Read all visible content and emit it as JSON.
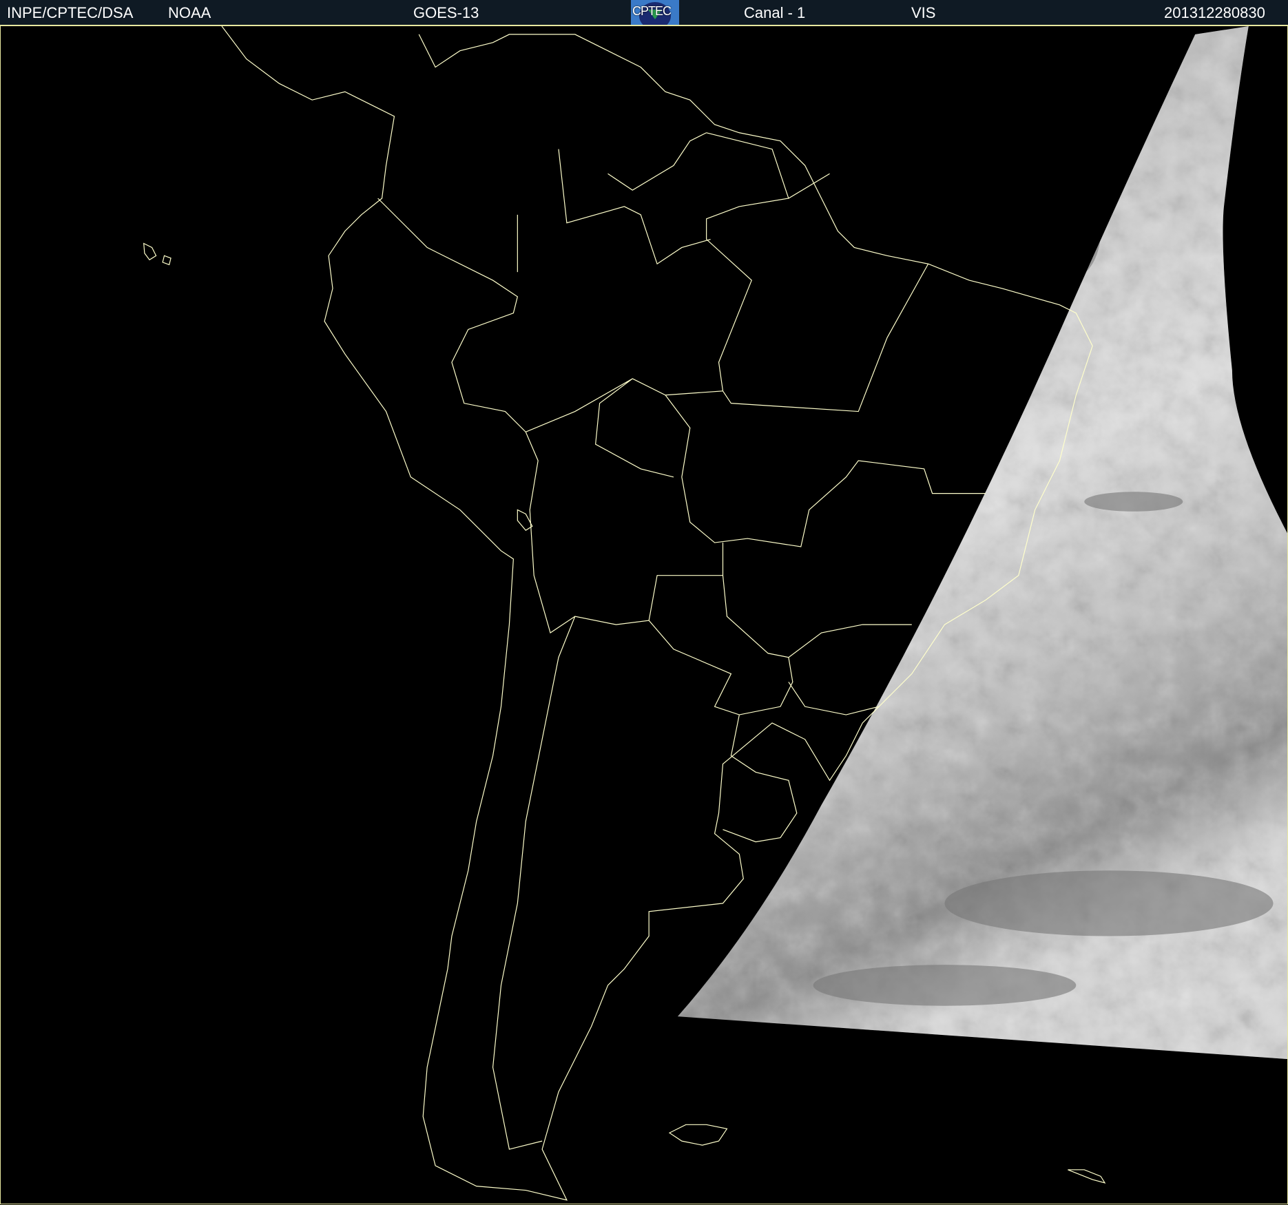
{
  "header": {
    "institution": "INPE/CPTEC/DSA",
    "agency": "NOAA",
    "satellite": "GOES-13",
    "logo_text": "CPTEC",
    "channel": "Canal - 1",
    "band": "VIS",
    "timestamp": "201312280830"
  },
  "map": {
    "region": "South America",
    "background_color": "#000000",
    "border_color": "#ffffcc",
    "imagery": "visible satellite image swath (grayscale clouds) over eastern Brazil and South Atlantic"
  }
}
